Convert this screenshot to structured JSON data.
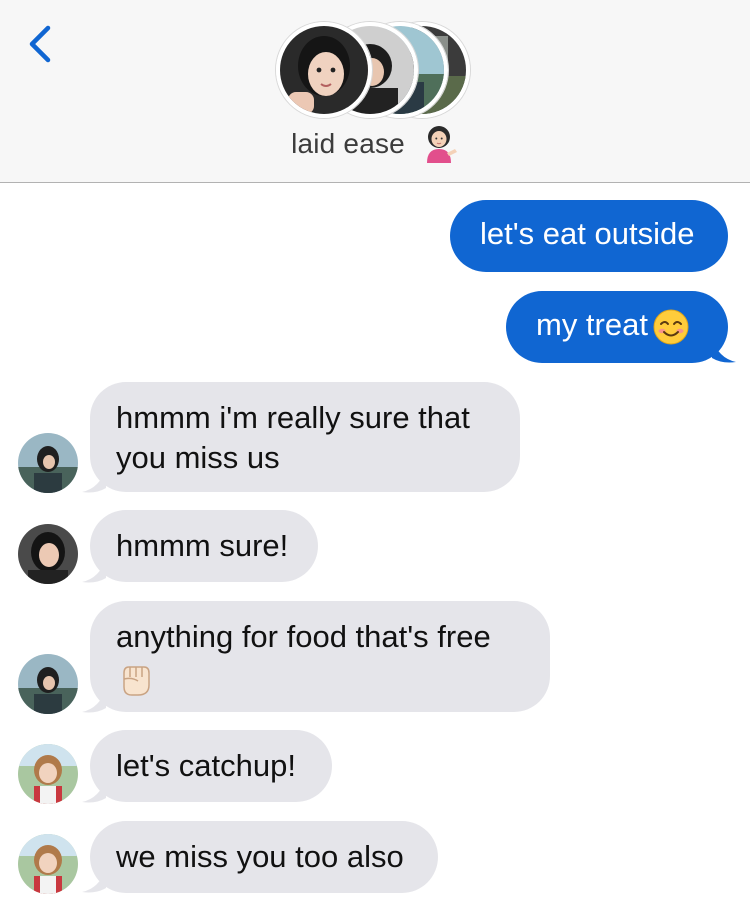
{
  "header": {
    "back_icon": "chevron-left-icon",
    "group_name": "laid ease",
    "group_emoji": "woman-tipping-hand-emoji",
    "accent_color": "#1066d2"
  },
  "messages": [
    {
      "direction": "sent",
      "text": "let's eat outside"
    },
    {
      "direction": "sent",
      "text": "my treat",
      "emoji": "smiling-face-emoji"
    },
    {
      "direction": "received",
      "sender_avatar": "avatar-b",
      "lines": [
        "hmmm i'm really sure that",
        "you miss us"
      ]
    },
    {
      "direction": "received",
      "sender_avatar": "avatar-a",
      "text": "hmmm sure!"
    },
    {
      "direction": "received",
      "sender_avatar": "avatar-b",
      "text": "anything for food that's free",
      "emoji": "raised-fist-emoji"
    },
    {
      "direction": "received",
      "sender_avatar": "avatar-c",
      "text": "let's catchup!"
    },
    {
      "direction": "received",
      "sender_avatar": "avatar-c",
      "text": "we miss you too also"
    }
  ],
  "colors": {
    "sent_bubble": "#1066d2",
    "received_bubble": "#e5e5ea",
    "header_bg": "#f7f7f7"
  }
}
